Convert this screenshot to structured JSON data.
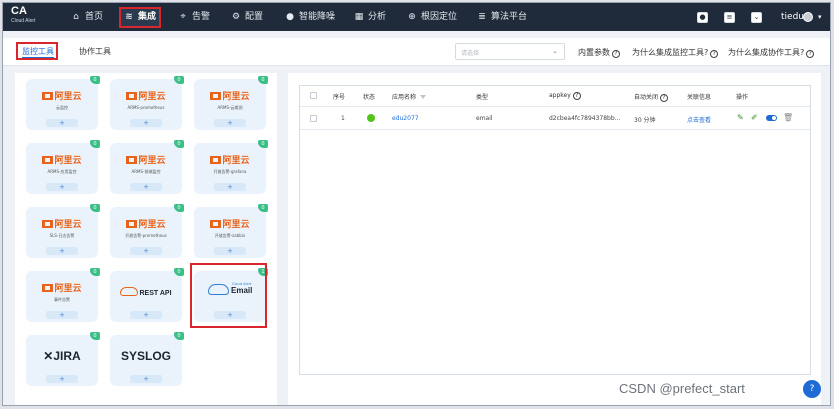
{
  "brand": {
    "short": "CA",
    "name": "Cloud Alert"
  },
  "nav": [
    {
      "label": "首页",
      "icon": "home-icon",
      "glyph": "⌂"
    },
    {
      "label": "集成",
      "icon": "layers-icon",
      "glyph": "≋"
    },
    {
      "label": "告警",
      "icon": "alarm-icon",
      "glyph": "⌖"
    },
    {
      "label": "配置",
      "icon": "gear-icon",
      "glyph": "⚙"
    },
    {
      "label": "智能降噪",
      "icon": "noise-reduction-icon",
      "glyph": "●"
    },
    {
      "label": "分析",
      "icon": "chart-icon",
      "glyph": "▦"
    },
    {
      "label": "根因定位",
      "icon": "target-icon",
      "glyph": "⊕"
    },
    {
      "label": "算法平台",
      "icon": "algorithm-icon",
      "glyph": "≣"
    }
  ],
  "user": {
    "name": "tiedun"
  },
  "subtabs": {
    "monitor": "监控工具",
    "collab": "协作工具"
  },
  "select": {
    "placeholder": "请选择"
  },
  "links": {
    "builtin": "内置参数",
    "why_monitor": "为什么集成监控工具?",
    "why_collab": "为什么集成协作工具?"
  },
  "tools": [
    {
      "name": "阿里云",
      "caption": "云监控",
      "count": "0"
    },
    {
      "name": "阿里云",
      "caption": "ARMS-prometheus",
      "count": "0"
    },
    {
      "name": "阿里云",
      "caption": "ARMS-云拨测",
      "count": "0"
    },
    {
      "name": "阿里云",
      "caption": "ARMS-应用监控",
      "count": "0"
    },
    {
      "name": "阿里云",
      "caption": "ARMS-前端监控",
      "count": "0"
    },
    {
      "name": "阿里云",
      "caption": "开放告警-grafana",
      "count": "0"
    },
    {
      "name": "阿里云",
      "caption": "SLS-日志告警",
      "count": "0"
    },
    {
      "name": "阿里云",
      "caption": "开放告警-prometheus",
      "count": "0"
    },
    {
      "name": "阿里云",
      "caption": "开放告警-zabbix",
      "count": "0"
    },
    {
      "name": "阿里云",
      "caption": "事件告警",
      "count": "0"
    },
    {
      "name": "REST API",
      "caption": "",
      "count": "0"
    },
    {
      "name": "Email",
      "caption": "Cloud Alert",
      "count": "1"
    },
    {
      "name": "JIRA",
      "caption": "",
      "count": "0"
    },
    {
      "name": "SYSLOG",
      "caption": "",
      "count": "0"
    }
  ],
  "plus": "+",
  "table": {
    "headers": {
      "index": "序号",
      "status": "状态",
      "app": "应用名称",
      "type": "类型",
      "appkey": "appkey",
      "autoclose": "自动关闭",
      "related": "关联信息",
      "ops": "操作"
    },
    "rows": [
      {
        "index": "1",
        "status_color": "#52c41a",
        "app": "edu2077",
        "type": "email",
        "appkey": "d2cbea4fc7894378bb...",
        "autoclose": "30 分钟",
        "related": "点击查看"
      }
    ]
  },
  "watermark": "CSDN @prefect_start",
  "colors": {
    "nav_bg": "#1f2b3a",
    "accent": "#1e6bd6",
    "highlight": "#d9262c",
    "success": "#52c41a",
    "aliyun": "#e8641b"
  }
}
